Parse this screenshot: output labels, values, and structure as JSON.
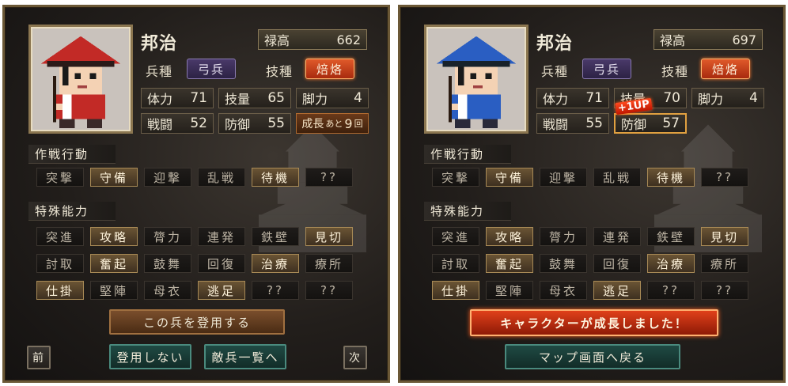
{
  "left": {
    "name": "邦治",
    "rokudaka_label": "禄高",
    "rokudaka_value": "662",
    "unit_type_label": "兵種",
    "unit_type_value": "弓兵",
    "skill_label": "技種",
    "skill_value": "焙烙",
    "stats": {
      "hp_label": "体力",
      "hp": "71",
      "skill_amt_label": "技量",
      "skill_amt": "65",
      "leg_label": "脚力",
      "leg": "4",
      "combat_label": "戦闘",
      "combat": "52",
      "defense_label": "防御",
      "defense": "55"
    },
    "growth": {
      "prefix": "成長",
      "small": "あと",
      "num": "9",
      "suffix": "回"
    },
    "tactics_header": "作戦行動",
    "tactics": [
      {
        "label": "突撃",
        "on": false
      },
      {
        "label": "守備",
        "on": true
      },
      {
        "label": "迎撃",
        "on": false
      },
      {
        "label": "乱戦",
        "on": false
      },
      {
        "label": "待機",
        "on": true
      },
      {
        "label": "??",
        "on": false
      }
    ],
    "abilities_header": "特殊能力",
    "abilities": [
      {
        "label": "突進",
        "on": false
      },
      {
        "label": "攻略",
        "on": true
      },
      {
        "label": "膂力",
        "on": false
      },
      {
        "label": "連発",
        "on": false
      },
      {
        "label": "鉄壁",
        "on": false
      },
      {
        "label": "見切",
        "on": true
      },
      {
        "label": "討取",
        "on": false
      },
      {
        "label": "奮起",
        "on": true
      },
      {
        "label": "鼓舞",
        "on": false
      },
      {
        "label": "回復",
        "on": false
      },
      {
        "label": "治療",
        "on": true
      },
      {
        "label": "療所",
        "on": false
      },
      {
        "label": "仕掛",
        "on": true
      },
      {
        "label": "堅陣",
        "on": false
      },
      {
        "label": "母衣",
        "on": false
      },
      {
        "label": "逃足",
        "on": true
      },
      {
        "label": "??",
        "on": false
      },
      {
        "label": "??",
        "on": false
      }
    ],
    "recruit_button": "この兵を登用する",
    "prev_button": "前",
    "decline_button": "登用しない",
    "enemy_list_button": "敵兵一覧へ",
    "next_button": "次",
    "hat_color": "#c22a26"
  },
  "right": {
    "name": "邦治",
    "rokudaka_label": "禄高",
    "rokudaka_value": "697",
    "unit_type_label": "兵種",
    "unit_type_value": "弓兵",
    "skill_label": "技種",
    "skill_value": "焙烙",
    "stats": {
      "hp_label": "体力",
      "hp": "71",
      "skill_amt_label": "技量",
      "skill_amt": "70",
      "leg_label": "脚力",
      "leg": "4",
      "combat_label": "戦闘",
      "combat": "55",
      "defense_label": "防御",
      "defense": "57"
    },
    "oneup": "+1UP",
    "tactics_header": "作戦行動",
    "tactics": [
      {
        "label": "突撃",
        "on": false
      },
      {
        "label": "守備",
        "on": true
      },
      {
        "label": "迎撃",
        "on": false
      },
      {
        "label": "乱戦",
        "on": false
      },
      {
        "label": "待機",
        "on": true
      },
      {
        "label": "??",
        "on": false
      }
    ],
    "abilities_header": "特殊能力",
    "abilities": [
      {
        "label": "突進",
        "on": false
      },
      {
        "label": "攻略",
        "on": true
      },
      {
        "label": "膂力",
        "on": false
      },
      {
        "label": "連発",
        "on": false
      },
      {
        "label": "鉄壁",
        "on": false
      },
      {
        "label": "見切",
        "on": true
      },
      {
        "label": "討取",
        "on": false
      },
      {
        "label": "奮起",
        "on": true
      },
      {
        "label": "鼓舞",
        "on": false
      },
      {
        "label": "回復",
        "on": false
      },
      {
        "label": "治療",
        "on": true
      },
      {
        "label": "療所",
        "on": false
      },
      {
        "label": "仕掛",
        "on": true
      },
      {
        "label": "堅陣",
        "on": false
      },
      {
        "label": "母衣",
        "on": false
      },
      {
        "label": "逃足",
        "on": true
      },
      {
        "label": "??",
        "on": false
      },
      {
        "label": "??",
        "on": false
      }
    ],
    "grow_message": "キャラクターが成長しました！",
    "map_button": "マップ画面へ戻る",
    "hat_color": "#2a5ec2"
  }
}
